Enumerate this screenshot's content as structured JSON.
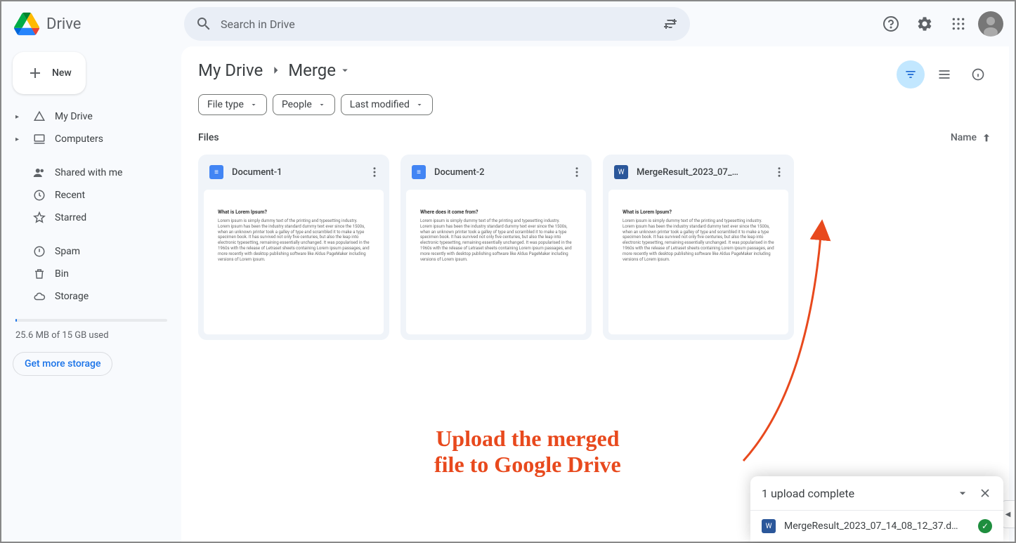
{
  "app": {
    "name": "Drive"
  },
  "search": {
    "placeholder": "Search in Drive"
  },
  "new_button": "New",
  "sidebar": {
    "items": [
      {
        "label": "My Drive",
        "icon": "drive",
        "expandable": true
      },
      {
        "label": "Computers",
        "icon": "computer",
        "expandable": true
      },
      {
        "label": "Shared with me",
        "icon": "people",
        "expandable": false
      },
      {
        "label": "Recent",
        "icon": "clock",
        "expandable": false
      },
      {
        "label": "Starred",
        "icon": "star",
        "expandable": false
      },
      {
        "label": "Spam",
        "icon": "spam",
        "expandable": false
      },
      {
        "label": "Bin",
        "icon": "trash",
        "expandable": false
      },
      {
        "label": "Storage",
        "icon": "cloud",
        "expandable": false
      }
    ],
    "storage_text": "25.6 MB of 15 GB used",
    "storage_cta": "Get more storage"
  },
  "breadcrumb": {
    "parent": "My Drive",
    "current": "Merge"
  },
  "filters": [
    {
      "label": "File type"
    },
    {
      "label": "People"
    },
    {
      "label": "Last modified"
    }
  ],
  "section_label": "Files",
  "sort_label": "Name",
  "files": [
    {
      "name": "Document-1",
      "type": "docs",
      "preview_title": "What is Lorem Ipsum?"
    },
    {
      "name": "Document-2",
      "type": "docs",
      "preview_title": "Where does it come from?"
    },
    {
      "name": "MergeResult_2023_07_…",
      "type": "word",
      "preview_title": "What is Lorem Ipsum?"
    }
  ],
  "annotation": {
    "text": "Upload the merged\nfile to Google Drive"
  },
  "toast": {
    "title": "1 upload complete",
    "item_name": "MergeResult_2023_07_14_08_12_37.d…"
  }
}
